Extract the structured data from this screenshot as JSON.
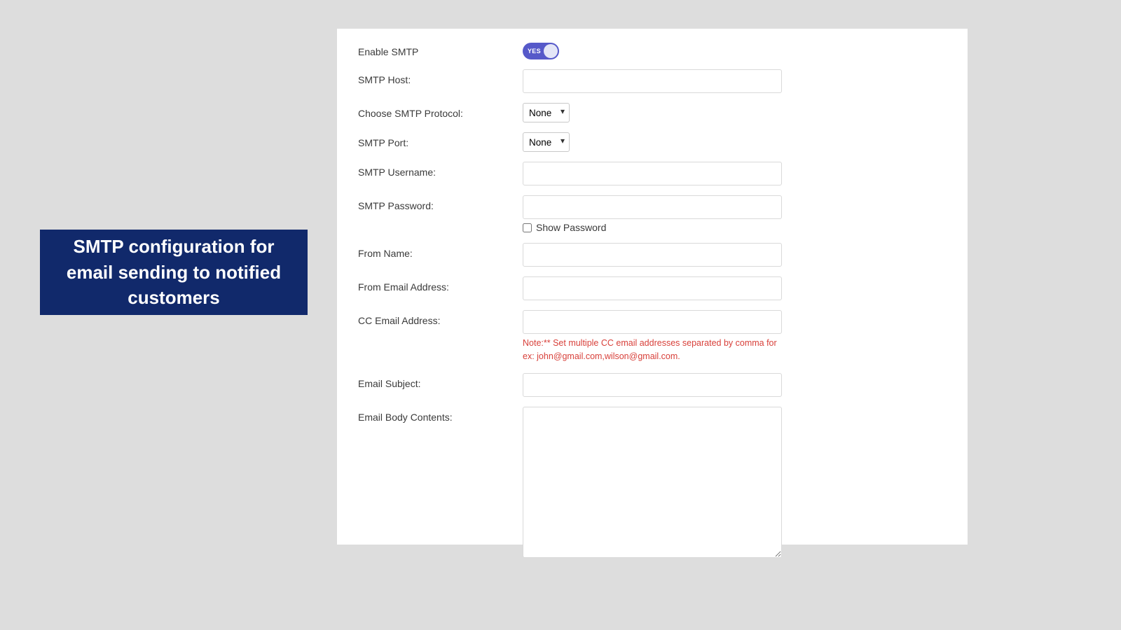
{
  "caption": "SMTP configuration for email sending to notified customers",
  "form": {
    "enable_smtp_label": "Enable SMTP",
    "enable_smtp_toggle_text": "YES",
    "enable_smtp_value": true,
    "smtp_host_label": "SMTP Host:",
    "smtp_host_value": "",
    "smtp_protocol_label": "Choose SMTP Protocol:",
    "smtp_protocol_selected": "None",
    "smtp_port_label": "SMTP Port:",
    "smtp_port_selected": "None",
    "smtp_username_label": "SMTP Username:",
    "smtp_username_value": "",
    "smtp_password_label": "SMTP Password:",
    "smtp_password_value": "",
    "show_password_label": "Show Password",
    "show_password_checked": false,
    "from_name_label": "From Name:",
    "from_name_value": "",
    "from_email_label": "From Email Address:",
    "from_email_value": "",
    "cc_email_label": "CC Email Address:",
    "cc_email_value": "",
    "cc_note": "Note:** Set multiple CC email addresses separated by comma for ex: john@gmail.com,wilson@gmail.com.",
    "email_subject_label": "Email Subject:",
    "email_subject_value": "",
    "email_body_label": "Email Body Contents:",
    "email_body_value": ""
  }
}
